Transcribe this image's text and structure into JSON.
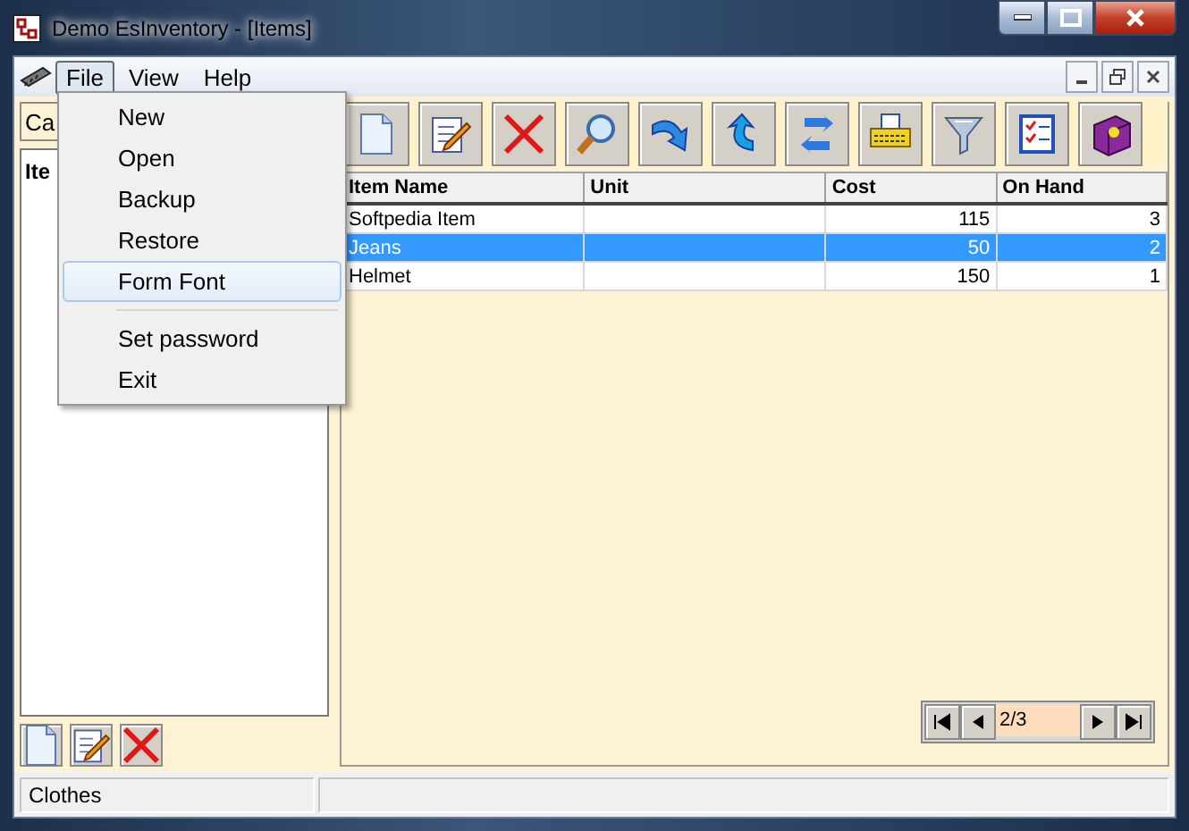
{
  "window": {
    "title": "Demo EsInventory - [Items]"
  },
  "menu": [
    {
      "label": "File",
      "selected": true
    },
    {
      "label": "View",
      "selected": false
    },
    {
      "label": "Help",
      "selected": false
    }
  ],
  "file_menu": [
    {
      "kind": "item",
      "label": "New",
      "selected": false
    },
    {
      "kind": "item",
      "label": "Open",
      "selected": false
    },
    {
      "kind": "item",
      "label": "Backup",
      "selected": false
    },
    {
      "kind": "item",
      "label": "Restore",
      "selected": false
    },
    {
      "kind": "item",
      "label": "Form Font",
      "selected": true
    },
    {
      "kind": "separator"
    },
    {
      "kind": "item",
      "label": "Set password",
      "selected": false
    },
    {
      "kind": "item",
      "label": "Exit",
      "selected": false
    }
  ],
  "category_field": {
    "value": "Ca"
  },
  "category_list": {
    "header": "Ite"
  },
  "table": {
    "columns": [
      {
        "label": "Item Name",
        "kind": "text"
      },
      {
        "label": "Unit",
        "kind": "text"
      },
      {
        "label": "Cost",
        "kind": "number"
      },
      {
        "label": "On Hand",
        "kind": "number"
      }
    ],
    "rows": [
      {
        "cells": [
          "Softpedia Item",
          "",
          "115",
          "3"
        ],
        "selected": false
      },
      {
        "cells": [
          "Jeans",
          "",
          "50",
          "2"
        ],
        "selected": true
      },
      {
        "cells": [
          "Helmet",
          "",
          "150",
          "1"
        ],
        "selected": false
      }
    ]
  },
  "navigator": {
    "position": "2/3"
  },
  "status_bar": {
    "panels": [
      "Clothes"
    ]
  }
}
